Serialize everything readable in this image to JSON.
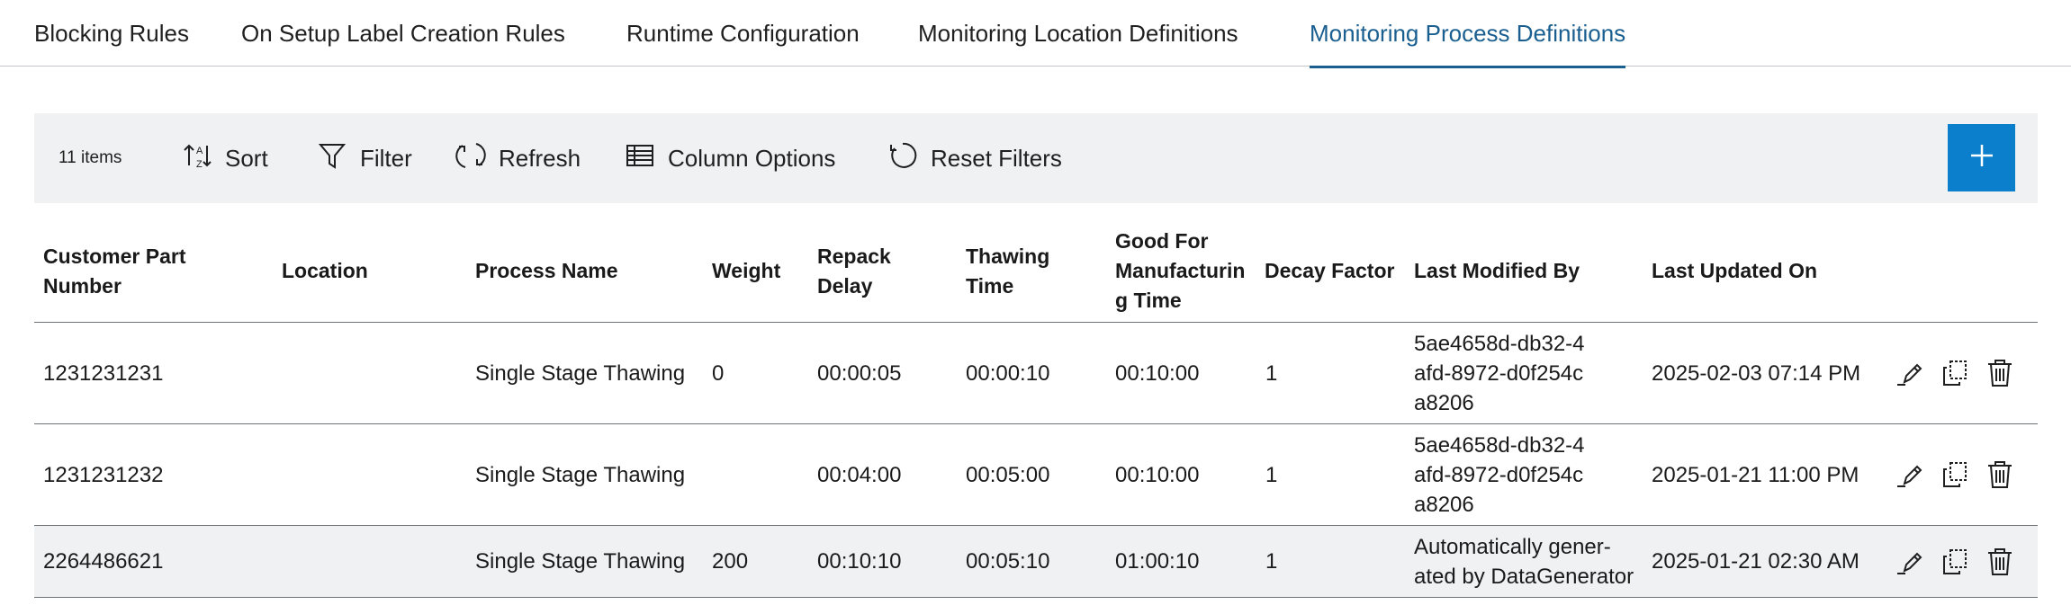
{
  "tabs": [
    {
      "label": "Blocking Rules"
    },
    {
      "label": "On Setup Label Creation Rules"
    },
    {
      "label": "Runtime Configuration"
    },
    {
      "label": "Monitoring Location Definitions"
    },
    {
      "label": "Monitoring Process Definitions",
      "active": true
    }
  ],
  "toolbar": {
    "items_count": "11 items",
    "sort": "Sort",
    "filter": "Filter",
    "refresh": "Refresh",
    "column_options": "Column Options",
    "reset_filters": "Reset Filters",
    "add_icon": "plus-icon"
  },
  "table": {
    "columns": [
      "Customer Part Number",
      "Location",
      "Process Name",
      "Weight",
      "Repack Delay",
      "Thawing Time",
      "Good For Manufacturin g Time",
      "Decay Factor",
      "Last Modified By",
      "Last Updated On"
    ],
    "rows": [
      {
        "customer_part_number": "1231231231",
        "location": "",
        "process_name": "Single Stage Thawing",
        "weight": "0",
        "repack_delay": "00:00:05",
        "thawing_time": "00:00:10",
        "good_for_manufacturing_time": "00:10:00",
        "decay_factor": "1",
        "last_modified_by": "5ae4658d-db32-4afd-8972-d0f254ca8206",
        "last_updated_on": "2025-02-03 07:14 PM"
      },
      {
        "customer_part_number": "1231231232",
        "location": "",
        "process_name": "Single Stage Thawing",
        "weight": "",
        "repack_delay": "00:04:00",
        "thawing_time": "00:05:00",
        "good_for_manufacturing_time": "00:10:00",
        "decay_factor": "1",
        "last_modified_by": "5ae4658d-db32-4afd-8972-d0f254ca8206",
        "last_updated_on": "2025-01-21 11:00 PM"
      },
      {
        "customer_part_number": "2264486621",
        "location": "",
        "process_name": "Single Stage Thawing",
        "weight": "200",
        "repack_delay": "00:10:10",
        "thawing_time": "00:05:10",
        "good_for_manufacturing_time": "01:00:10",
        "decay_factor": "1",
        "last_modified_by": "Automatically gener-ated by DataGenerator",
        "last_updated_on": "2025-01-21 02:30 AM"
      }
    ],
    "row_actions": [
      "edit-icon",
      "copy-icon",
      "delete-icon"
    ]
  },
  "colors": {
    "accent": "#1a5f8f",
    "add_button": "#0b7fcc",
    "toolbar_bg": "#eff1f2",
    "row_divider": "#6e7378"
  }
}
